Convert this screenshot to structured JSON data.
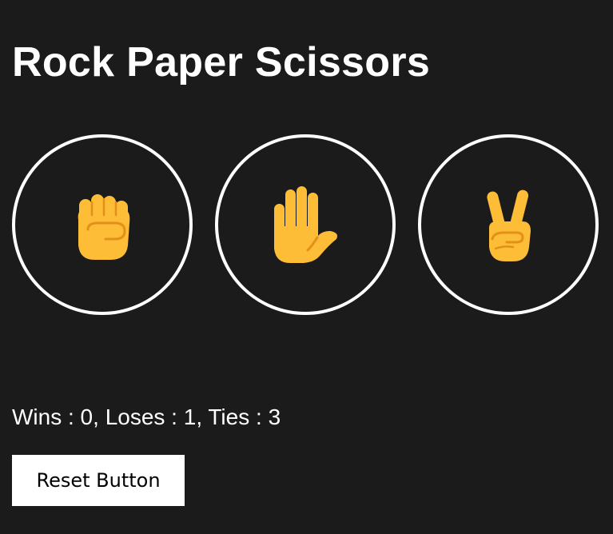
{
  "game": {
    "title": "Rock Paper Scissors",
    "choices": [
      {
        "name": "rock",
        "icon": "raised-fist-icon",
        "emoji": "✊"
      },
      {
        "name": "paper",
        "icon": "raised-hand-icon",
        "emoji": "🖐"
      },
      {
        "name": "scissors",
        "icon": "victory-hand-icon",
        "emoji": "✌"
      }
    ],
    "score_text": "Wins : 0, Loses : 1, Ties : 3",
    "score": {
      "wins": 0,
      "loses": 1,
      "ties": 3
    },
    "reset_label": "Reset Button"
  },
  "colors": {
    "background": "#1b1b1b",
    "foreground": "#ffffff",
    "emoji_skin": "#fdbd36",
    "emoji_line": "#e3901a"
  }
}
